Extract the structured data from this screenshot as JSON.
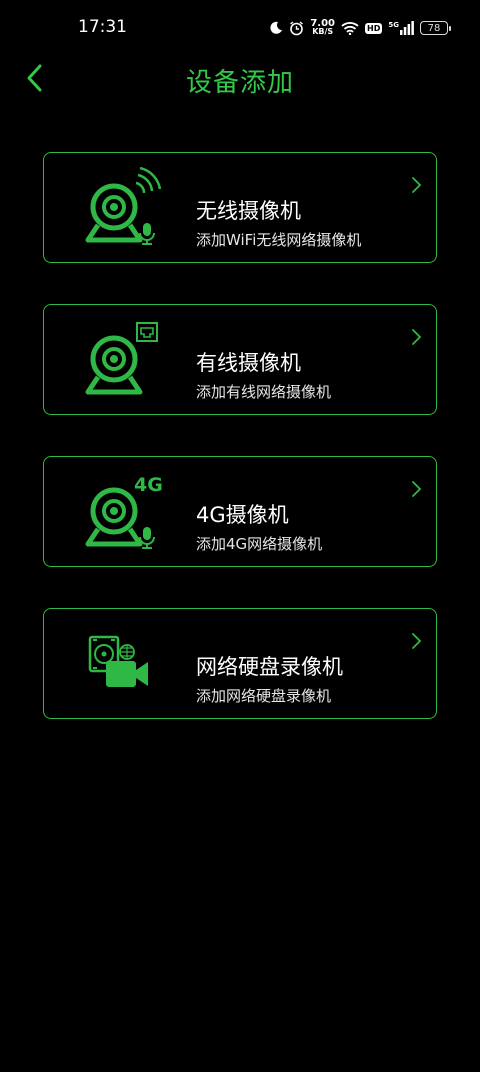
{
  "status_bar": {
    "time": "17:31",
    "network_speed_value": "7.00",
    "network_speed_unit": "KB/S",
    "hd_label": "HD",
    "signal_label": "5G",
    "battery_level": "78"
  },
  "header": {
    "title": "设备添加"
  },
  "options": [
    {
      "title": "无线摄像机",
      "subtitle": "添加WiFi无线网络摄像机",
      "icon": "wifi-camera-icon"
    },
    {
      "title": "有线摄像机",
      "subtitle": "添加有线网络摄像机",
      "icon": "wired-camera-icon"
    },
    {
      "title": "4G摄像机",
      "subtitle": "添加4G网络摄像机",
      "icon": "4g-camera-icon",
      "icon_badge": "4G"
    },
    {
      "title": "网络硬盘录像机",
      "subtitle": "添加网络硬盘录像机",
      "icon": "nvr-icon"
    }
  ],
  "colors": {
    "accent": "#34c84a",
    "background": "#000000",
    "card_border": "#2fb845"
  }
}
